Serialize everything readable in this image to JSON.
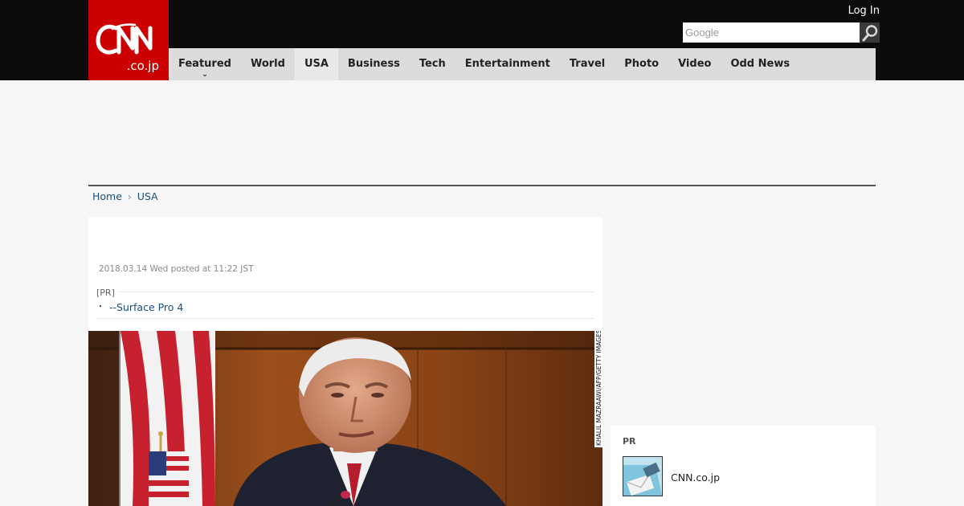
{
  "header": {
    "logo_top": "CNN",
    "logo_bottom": ".co.jp",
    "login_label": "Log In",
    "search_placeholder": "Google",
    "brand_color": "#cc0000"
  },
  "nav": {
    "items": [
      {
        "label": "Featured",
        "has_caret": true
      },
      {
        "label": "World"
      },
      {
        "label": "USA",
        "active": true
      },
      {
        "label": "Business"
      },
      {
        "label": "Tech"
      },
      {
        "label": "Entertainment"
      },
      {
        "label": "Travel"
      },
      {
        "label": "Photo"
      },
      {
        "label": "Video"
      },
      {
        "label": "Odd News"
      }
    ],
    "caret_glyph": "⌄"
  },
  "breadcrumb": {
    "home": "Home",
    "separator": "›",
    "current": "USA"
  },
  "article": {
    "posted": "2018.03.14 Wed posted at 11:22 JST",
    "pr_tag": "[PR]",
    "pr_bullet": "・",
    "pr_link": "--Surface Pro 4",
    "photo_credit": "KHALIL MAZRAAWI/AFP/GETTY IMAGES"
  },
  "sidebar": {
    "pr_title": "PR",
    "pr_item_text": "CNN.co.jp"
  }
}
